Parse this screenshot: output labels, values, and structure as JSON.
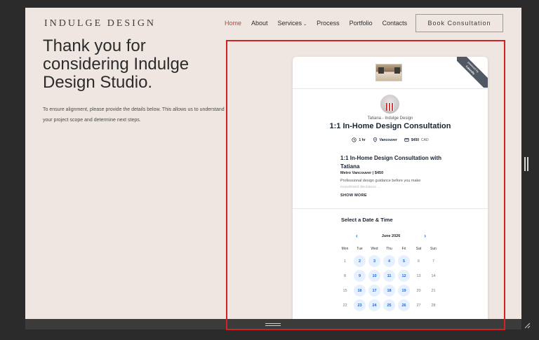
{
  "site": {
    "logo": "INDULGE DESIGN",
    "nav": [
      {
        "label": "Home",
        "active": true
      },
      {
        "label": "About"
      },
      {
        "label": "Services",
        "has_dropdown": true
      },
      {
        "label": "Process"
      },
      {
        "label": "Portfolio"
      },
      {
        "label": "Contacts"
      }
    ],
    "book_button": "Book Consultation",
    "hero_title": "Thank you for considering Indulge Design Studio.",
    "hero_desc": "To ensure alignment, please provide the details below. This allows us to understand your project scope and determine next steps."
  },
  "widget": {
    "ribbon_line1": "powered by",
    "ribbon_line2": "Calendly",
    "owner": "Tatiana - Indulge Design",
    "event_title": "1:1 In-Home Design Consultation",
    "duration": "1 hr",
    "location": "Vancouver",
    "price": "$450",
    "currency": "CAD",
    "desc_title": "1:1 In-Home Design Consultation with Tatiana",
    "desc_sub": "Metro Vancouver | $450",
    "desc_body": "Professional design guidance before you make",
    "desc_fade": "investment decisions ...",
    "show_more": "SHOW MORE",
    "select_title": "Select a Date & Time",
    "month": "June 2026",
    "weekdays": [
      "Mon",
      "Tue",
      "Wed",
      "Thu",
      "Fri",
      "Sat",
      "Sun"
    ],
    "days": [
      {
        "d": "1",
        "a": false
      },
      {
        "d": "2",
        "a": true
      },
      {
        "d": "3",
        "a": true
      },
      {
        "d": "4",
        "a": true
      },
      {
        "d": "5",
        "a": true
      },
      {
        "d": "6",
        "a": false
      },
      {
        "d": "7",
        "a": false
      },
      {
        "d": "8",
        "a": false
      },
      {
        "d": "9",
        "a": true
      },
      {
        "d": "10",
        "a": true
      },
      {
        "d": "11",
        "a": true
      },
      {
        "d": "12",
        "a": true
      },
      {
        "d": "13",
        "a": false
      },
      {
        "d": "14",
        "a": false
      },
      {
        "d": "15",
        "a": false
      },
      {
        "d": "16",
        "a": true
      },
      {
        "d": "17",
        "a": true
      },
      {
        "d": "18",
        "a": true
      },
      {
        "d": "19",
        "a": true
      },
      {
        "d": "20",
        "a": false
      },
      {
        "d": "21",
        "a": false
      },
      {
        "d": "22",
        "a": false
      },
      {
        "d": "23",
        "a": true
      },
      {
        "d": "24",
        "a": true
      },
      {
        "d": "25",
        "a": true
      },
      {
        "d": "26",
        "a": true
      },
      {
        "d": "27",
        "a": false
      },
      {
        "d": "28",
        "a": false
      }
    ]
  },
  "colors": {
    "page_bg": "#efe6e2",
    "accent": "#b3473a",
    "calendly_blue": "#0b69ff",
    "selection": "#d32020"
  }
}
